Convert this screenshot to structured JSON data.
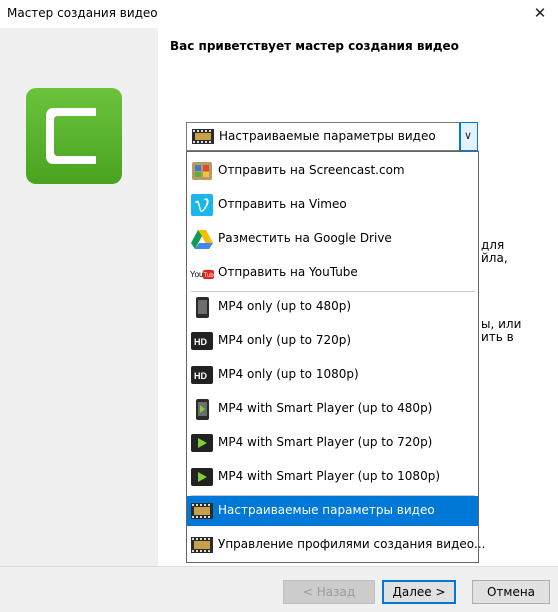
{
  "window": {
    "title": "Мастер создания видео",
    "close_glyph": "✕"
  },
  "heading": "Вас приветствует мастер создания видео",
  "logo": {
    "icon": "camtasia-c-logo",
    "color": "#5ab52a"
  },
  "combo": {
    "selected": "Настраиваемые параметры видео",
    "icon": "film-strip-icon"
  },
  "dropdown": {
    "items": [
      {
        "label": "Отправить на Screencast.com",
        "icon": "screencast-icon"
      },
      {
        "label": "Отправить на Vimeo",
        "icon": "vimeo-icon"
      },
      {
        "label": "Разместить на Google Drive",
        "icon": "google-drive-icon"
      },
      {
        "label": "Отправить на YouTube",
        "icon": "youtube-icon"
      },
      {
        "label": "MP4 only (up to 480p)",
        "icon": "phone-icon"
      },
      {
        "label": "MP4 only (up to 720p)",
        "icon": "hd-icon"
      },
      {
        "label": "MP4 only (up to 1080p)",
        "icon": "hd-icon"
      },
      {
        "label": "MP4 with Smart Player (up to 480p)",
        "icon": "phone-play-icon"
      },
      {
        "label": "MP4 with Smart Player (up to 720p)",
        "icon": "play-icon"
      },
      {
        "label": "MP4 with Smart Player (up to 1080p)",
        "icon": "play-icon"
      },
      {
        "label": "Настраиваемые параметры видео",
        "icon": "film-strip-icon"
      },
      {
        "label": "Управление профилями создания видео...",
        "icon": "film-strip-icon"
      }
    ],
    "selected_index": 10
  },
  "background_fragments": [
    "для",
    "йла,",
    "ы, или",
    "ить в"
  ],
  "buttons": {
    "back": "< Назад",
    "next": "Далее >",
    "cancel": "Отмена"
  }
}
